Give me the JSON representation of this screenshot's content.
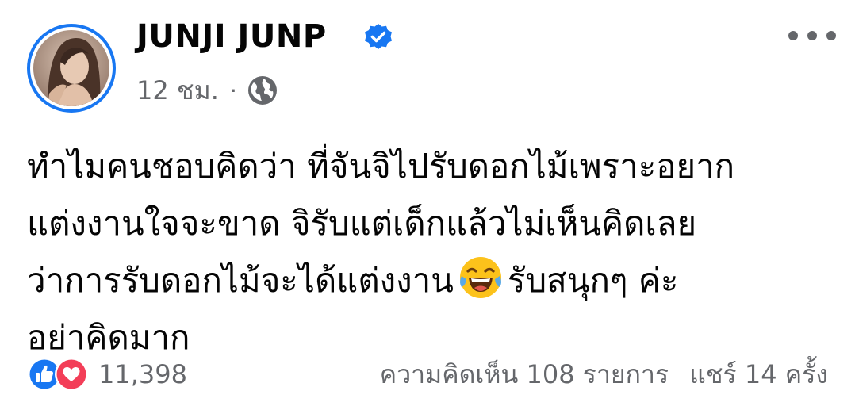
{
  "post": {
    "author": {
      "name": "JUNJI JUNP",
      "verified": true,
      "avatar_icon": "profile-photo"
    },
    "meta": {
      "time": "12 ชม.",
      "separator": "·",
      "audience_icon": "globe-icon"
    },
    "menu_icon": "more-dots-icon",
    "text_lines": [
      "ทำไมคนชอบคิดว่า ที่จันจิไปรับดอกไม้เพราะอยาก",
      "แต่งงานใจจะขาด จิรับแต่เด็กแล้วไม่เห็นคิดเลย",
      "ว่าการรับดอกไม้จะได้แต่งงาน",
      "รับสนุกๆ ค่ะ",
      "อย่าคิดมาก"
    ],
    "emoji": "laughing-tears-emoji",
    "reactions": {
      "types": [
        "like",
        "love"
      ],
      "count": "11,398"
    },
    "comments": "ความคิดเห็น 108 รายการ",
    "shares": "แชร์ 14 ครั้ง",
    "colors": {
      "brand_blue": "#1877f2",
      "secondary_text": "#65676b",
      "love_red": "#f33e58",
      "emoji_yellow": "#fcc21b"
    }
  }
}
